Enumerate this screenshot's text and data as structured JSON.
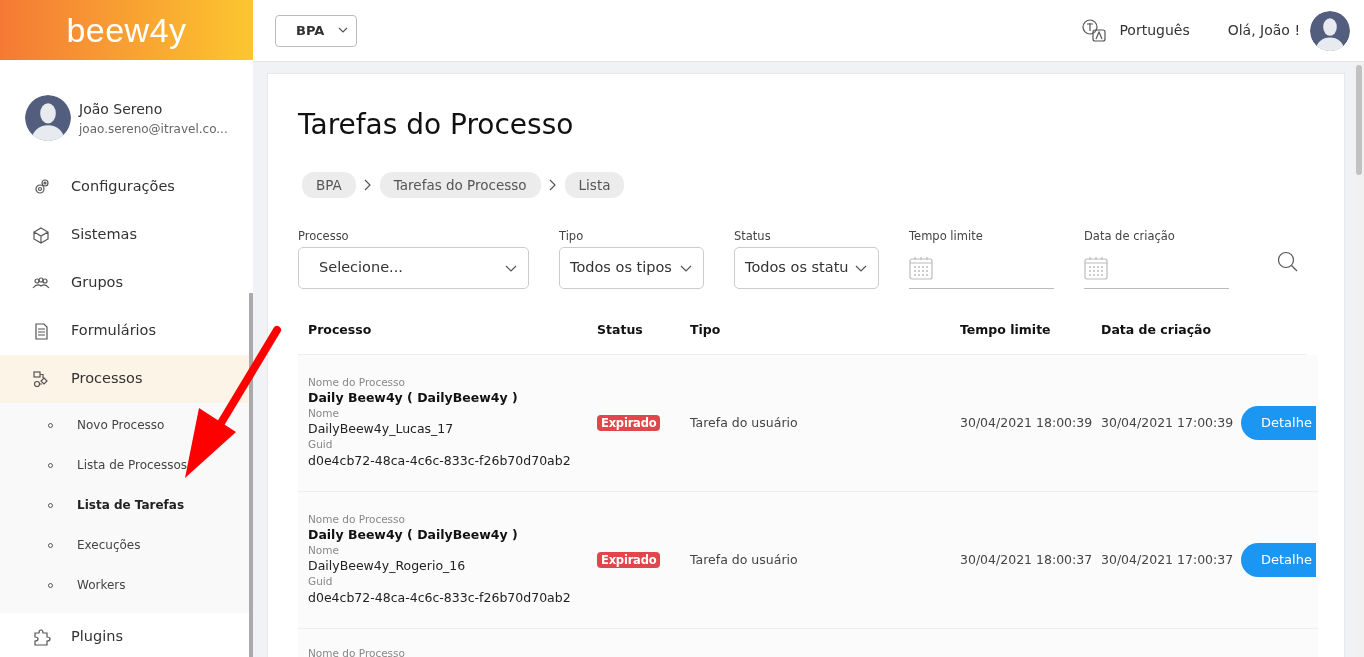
{
  "logo": "beew4y",
  "topbar": {
    "module_select": "BPA",
    "language": "Português",
    "greeting": "Olá, João !"
  },
  "user": {
    "name": "João Sereno",
    "email": "joao.sereno@itravel.co..."
  },
  "sidebar": {
    "items": [
      {
        "label": "Configurações",
        "selected": false
      },
      {
        "label": "Sistemas",
        "selected": false
      },
      {
        "label": "Grupos",
        "selected": false
      },
      {
        "label": "Formulários",
        "selected": false
      },
      {
        "label": "Processos",
        "selected": true,
        "children": [
          {
            "label": "Novo Processo",
            "selected": false
          },
          {
            "label": "Lista de Processos",
            "selected": false
          },
          {
            "label": "Lista de Tarefas",
            "selected": true
          },
          {
            "label": "Execuções",
            "selected": false
          },
          {
            "label": "Workers",
            "selected": false
          }
        ]
      },
      {
        "label": "Plugins",
        "selected": false
      }
    ]
  },
  "page": {
    "title": "Tarefas do Processo",
    "breadcrumb": [
      "BPA",
      "Tarefas do Processo",
      "Lista"
    ]
  },
  "filters": [
    {
      "kind": "select",
      "label": "Processo",
      "value": "Selecione..."
    },
    {
      "kind": "select",
      "label": "Tipo",
      "value": "Todos os tipos"
    },
    {
      "kind": "select",
      "label": "Status",
      "value": "Todos os statu"
    },
    {
      "kind": "date",
      "label": "Tempo limite"
    },
    {
      "kind": "date",
      "label": "Data de criação"
    }
  ],
  "table": {
    "columns": [
      "Processo",
      "Status",
      "Tipo",
      "Tempo limite",
      "Data de criação"
    ],
    "rows": [
      {
        "process_label": "Nome do Processo",
        "process": "Daily Beew4y ( DailyBeew4y )",
        "name_label": "Nome",
        "name": "DailyBeew4y_Lucas_17",
        "guid_label": "Guid",
        "guid": "d0e4cb72-48ca-4c6c-833c-f26b70d70ab2",
        "status": "Expirado",
        "type": "Tarefa do usuário",
        "deadline": "30/04/2021 18:00:39",
        "created": "30/04/2021 17:00:39",
        "action": "Detalhe"
      },
      {
        "process_label": "Nome do Processo",
        "process": "Daily Beew4y ( DailyBeew4y )",
        "name_label": "Nome",
        "name": "DailyBeew4y_Rogerio_16",
        "guid_label": "Guid",
        "guid": "d0e4cb72-48ca-4c6c-833c-f26b70d70ab2",
        "status": "Expirado",
        "type": "Tarefa do usuário",
        "deadline": "30/04/2021 18:00:37",
        "created": "30/04/2021 17:00:37",
        "action": "Detalhe"
      },
      {
        "process_label": "Nome do Processo"
      }
    ]
  }
}
